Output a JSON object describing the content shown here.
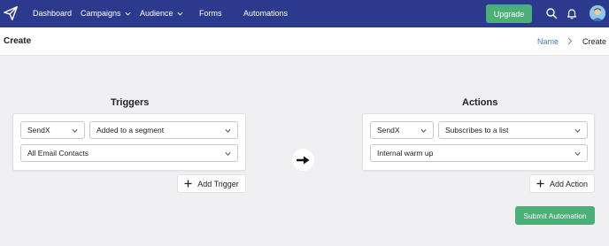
{
  "nav": {
    "items": [
      "Dashboard",
      "Campaigns",
      "Audience",
      "Forms",
      "Automations"
    ],
    "upgrade_label": "Upgrade"
  },
  "header": {
    "title": "Create",
    "breadcrumb": [
      "Name",
      "Create"
    ]
  },
  "triggers": {
    "title": "Triggers",
    "provider": "SendX",
    "event": "Added to a segment",
    "segment": "All Email Contacts",
    "add_label": "Add Trigger"
  },
  "actions": {
    "title": "Actions",
    "provider": "SendX",
    "action": "Subscribes to a list",
    "list": "Internal warm up",
    "add_label": "Add Action"
  },
  "submit_label": "Submit Automation",
  "colors": {
    "nav_bg": "#2b3a8c",
    "accent_green": "#4caf78",
    "link_blue": "#3f7fc8",
    "page_bg": "#f0f0f3"
  }
}
